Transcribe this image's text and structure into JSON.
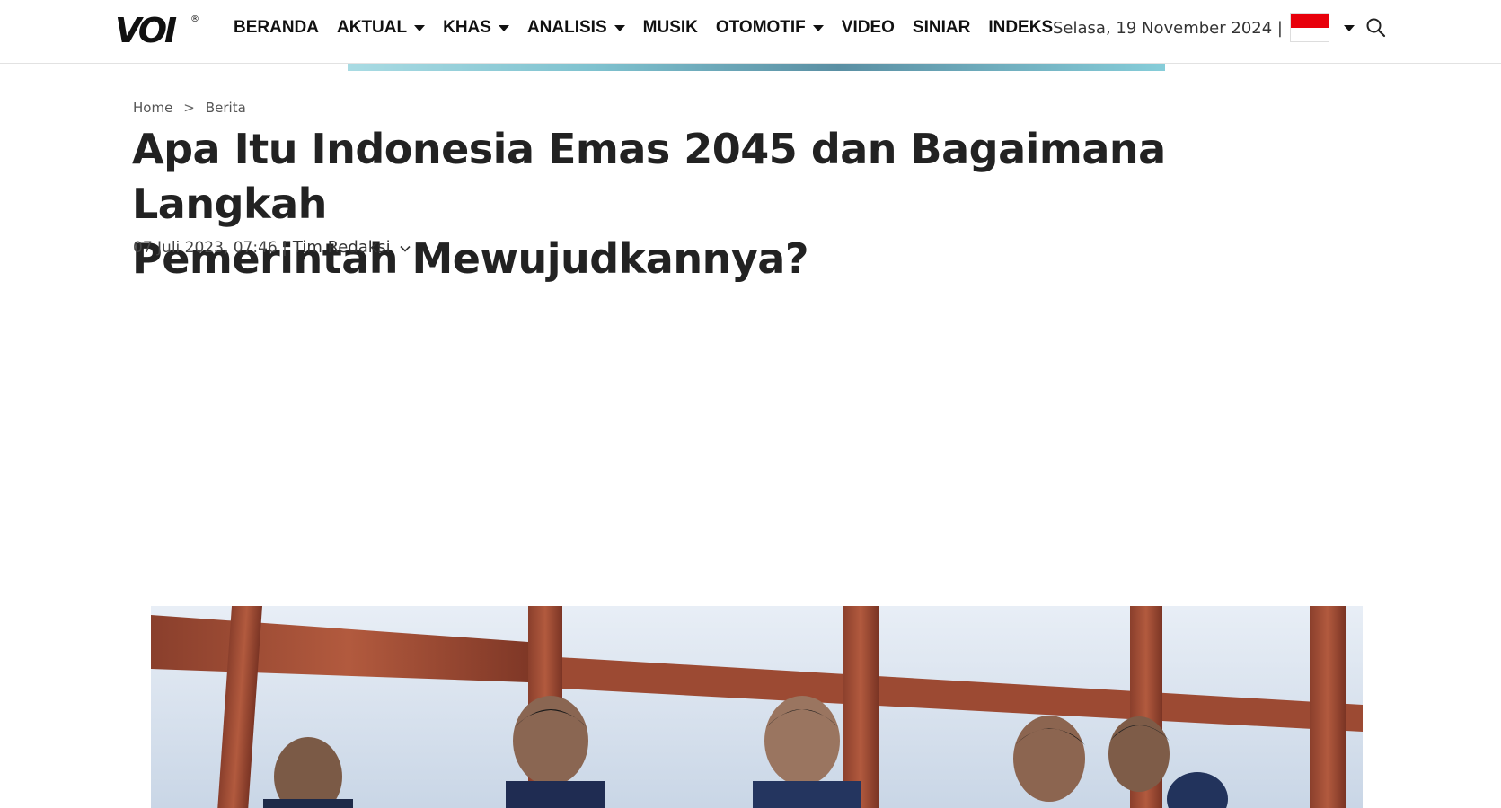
{
  "header": {
    "logo": "VOI",
    "nav": [
      {
        "label": "BERANDA",
        "dropdown": false
      },
      {
        "label": "AKTUAL",
        "dropdown": true
      },
      {
        "label": "KHAS",
        "dropdown": true
      },
      {
        "label": "ANALISIS",
        "dropdown": true
      },
      {
        "label": "MUSIK",
        "dropdown": false
      },
      {
        "label": "OTOMOTIF",
        "dropdown": true
      },
      {
        "label": "VIDEO",
        "dropdown": false
      },
      {
        "label": "SINIAR",
        "dropdown": false
      },
      {
        "label": "INDEKS",
        "dropdown": false
      }
    ],
    "date": "Selasa, 19 November 2024 |",
    "language_flag": "indonesia-flag-icon",
    "search_icon": "search-icon"
  },
  "breadcrumb": {
    "home": "Home",
    "separator": ">",
    "section": "Berita"
  },
  "article": {
    "title_line1": "Apa Itu Indonesia Emas 2045 dan Bagaimana Langkah",
    "title_line2": "Pemerintah Mewujudkannya?",
    "datetime": "07 Juli 2023, 07:46 |",
    "author": "Tim Redaksi"
  },
  "colors": {
    "flag_red": "#e8000b",
    "text_dark": "#222222",
    "border": "#e2e2e2"
  }
}
